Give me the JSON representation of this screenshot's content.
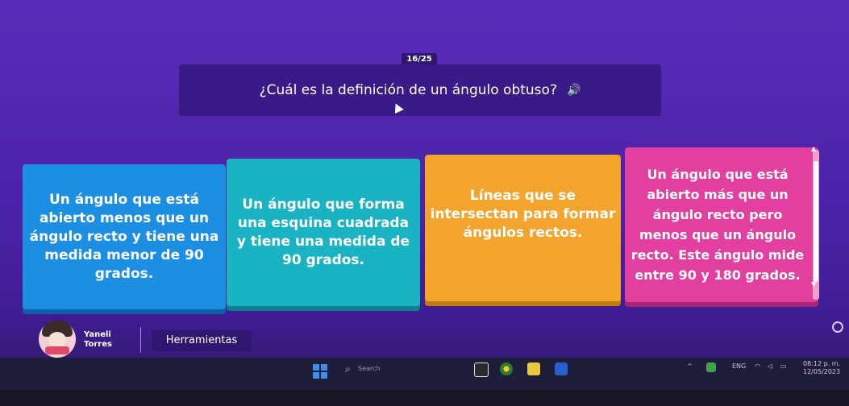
{
  "quiz": {
    "counter": "16/25",
    "question": "¿Cuál es la definición de un ángulo obtuso?",
    "answers": [
      {
        "text": "Un ángulo que está abierto menos que un ángulo recto y tiene una medida menor de 90 grados.",
        "color": "#1d8fe3"
      },
      {
        "text": "Un ángulo que forma una esquina cuadrada y tiene una medida de 90 grados.",
        "color": "#19b3c4"
      },
      {
        "text": "Líneas que se intersectan para formar ángulos rectos.",
        "color": "#f2a42c"
      },
      {
        "text": "Un ángulo que está abierto más que un ángulo recto pero menos que un ángulo recto. Este ángulo mide entre 90 y 180 grados.",
        "color": "#e23fa0"
      }
    ]
  },
  "player": {
    "name_line1": "Yaneli",
    "name_line2": "Torres",
    "tools_label": "Herramientas"
  },
  "taskbar": {
    "search_placeholder": "Search",
    "language": "ENG",
    "time": "08:12 p. m.",
    "date": "12/05/2023"
  },
  "icons": {
    "speaker": "speaker-icon",
    "settings": "gear-icon"
  }
}
